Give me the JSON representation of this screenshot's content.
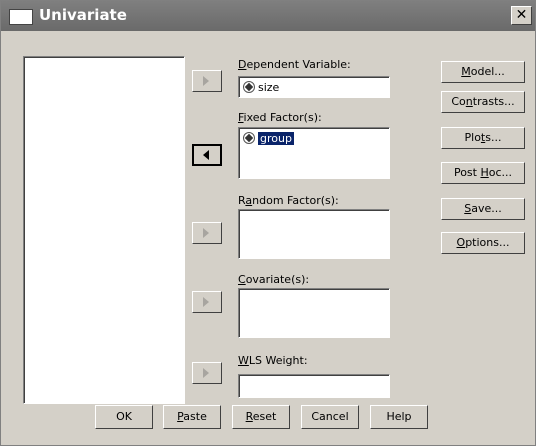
{
  "window": {
    "title": "Univariate",
    "close_glyph": "✕"
  },
  "fields": {
    "dependent_label_acc": "D",
    "dependent_label_rest": "ependent Variable:",
    "dependent_value": "size",
    "fixed_label_acc": "F",
    "fixed_label_rest": "ixed Factor(s):",
    "fixed_items": [
      "group"
    ],
    "random_label_pre": "R",
    "random_label_acc": "a",
    "random_label_rest": "ndom Factor(s):",
    "covariates_label_acc": "C",
    "covariates_label_rest": "ovariate(s):",
    "wls_label_pre": "",
    "wls_label_acc": "W",
    "wls_label_rest": "LS Weight:"
  },
  "side_buttons": {
    "model_pre": "",
    "model_acc": "M",
    "model_rest": "odel...",
    "contrasts_pre": "Co",
    "contrasts_acc": "n",
    "contrasts_rest": "trasts...",
    "plots_pre": "Plo",
    "plots_acc": "t",
    "plots_rest": "s...",
    "posthoc_pre": "Post ",
    "posthoc_acc": "H",
    "posthoc_rest": "oc...",
    "save_pre": "",
    "save_acc": "S",
    "save_rest": "ave...",
    "options_pre": "",
    "options_acc": "O",
    "options_rest": "ptions..."
  },
  "bottom_buttons": {
    "ok": "OK",
    "paste_acc": "P",
    "paste_rest": "aste",
    "reset_acc": "R",
    "reset_rest": "eset",
    "cancel": "Cancel",
    "help": "Help"
  }
}
